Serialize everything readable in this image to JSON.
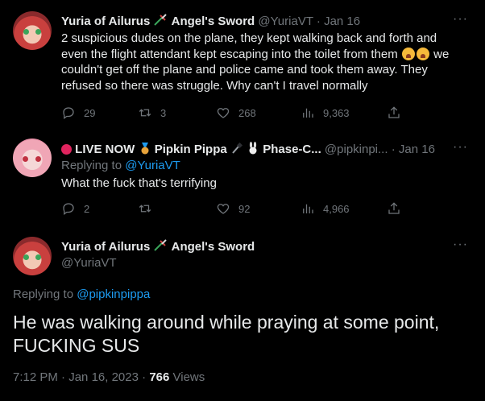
{
  "tweet1": {
    "name": "Yuria of Ailurus",
    "name_suffix": "Angel's Sword",
    "handle": "@YuriaVT",
    "date": "Jan 16",
    "text_a": "2 suspicious dudes on the plane, they kept walking back and forth and even the flight attendant kept escaping into the toilet from them",
    "text_b": "we couldn't get off the plane and police came and took them away. They refused so there was struggle. Why can't I travel normally",
    "replies": "29",
    "retweets": "3",
    "likes": "268",
    "views": "9,363"
  },
  "tweet2": {
    "live": "LIVE NOW",
    "name": "Pipkin Pippa",
    "name_suffix": "Phase-C...",
    "handle": "@pipkinpi...",
    "date": "Jan 16",
    "replying_label": "Replying to",
    "replying_to": "@YuriaVT",
    "text": "What the fuck that's terrifying",
    "replies": "2",
    "retweets": "",
    "likes": "92",
    "views": "4,966"
  },
  "tweet3": {
    "name": "Yuria of Ailurus",
    "name_suffix": "Angel's Sword",
    "handle": "@YuriaVT",
    "replying_label": "Replying to",
    "replying_to": "@pipkinpippa",
    "text": "He was walking around while praying at some point, FUCKING SUS",
    "time": "7:12 PM",
    "date": "Jan 16, 2023",
    "views_count": "766",
    "views_label": "Views"
  },
  "separator": "·",
  "more": "···",
  "icons": {
    "reply": "reply-icon",
    "retweet": "retweet-icon",
    "like": "heart-icon",
    "views": "views-icon",
    "share": "share-icon"
  },
  "colors": {
    "background": "#000000",
    "text": "#e7e9ea",
    "muted": "#71767b",
    "link": "#1d9bf0"
  }
}
